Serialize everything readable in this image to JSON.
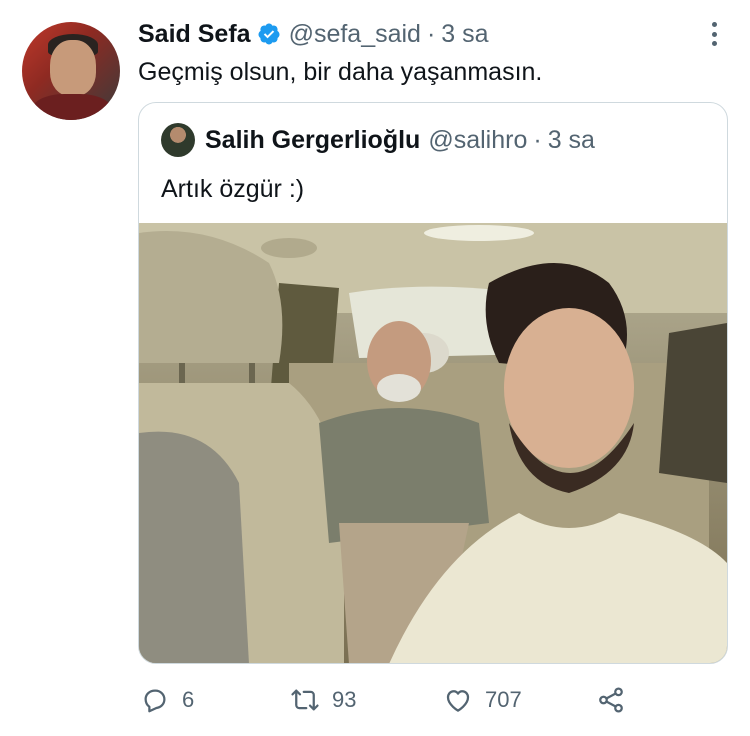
{
  "tweet": {
    "author_name": "Said Sefa",
    "handle": "@sefa_said",
    "separator": "·",
    "time": "3 sa",
    "text": "Geçmiş olsun, bir daha yaşanmasın.",
    "verified": true,
    "accent_color": "#1d9bf0"
  },
  "quoted_tweet": {
    "author_name": "Salih Gergerlioğlu",
    "handle": "@salihro",
    "separator": "·",
    "time": "3 sa",
    "text": "Artık özgür :)"
  },
  "actions": {
    "reply": {
      "icon": "reply-icon",
      "count": "6"
    },
    "retweet": {
      "icon": "retweet-icon",
      "count": "93"
    },
    "like": {
      "icon": "heart-icon",
      "count": "707"
    },
    "share": {
      "icon": "share-icon"
    }
  }
}
